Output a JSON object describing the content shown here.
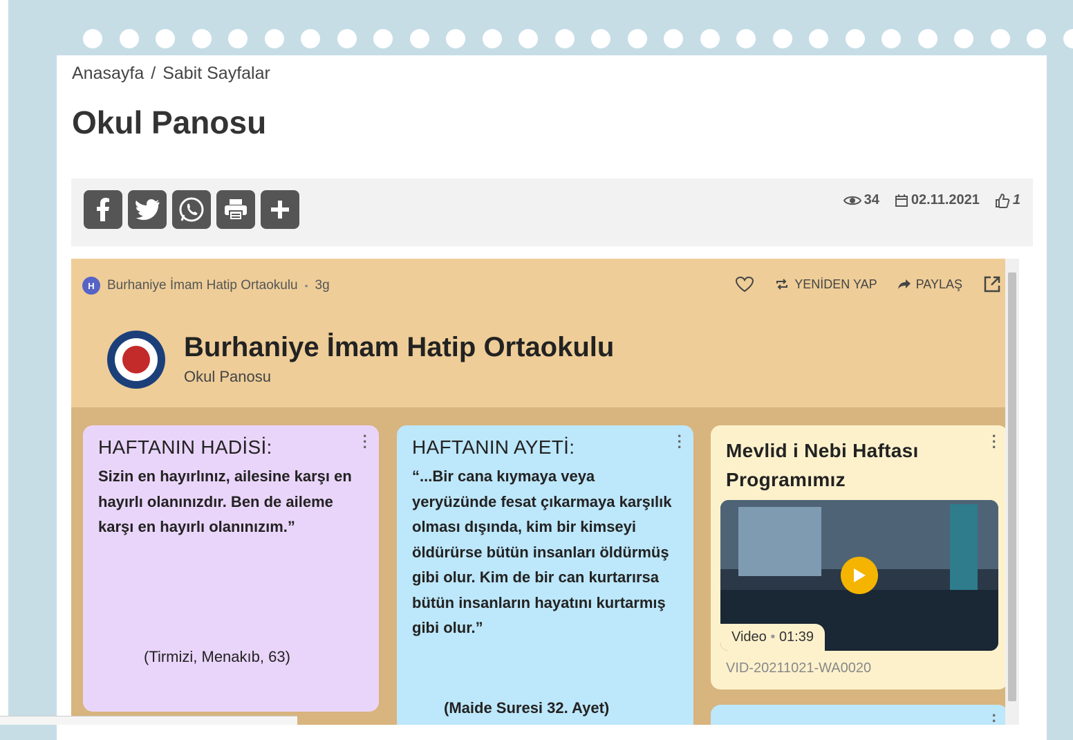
{
  "breadcrumb": {
    "home": "Anasayfa",
    "sep": "/",
    "current": "Sabit Sayfalar"
  },
  "page_title": "Okul Panosu",
  "share_buttons": [
    {
      "icon": "facebook-icon",
      "glyph": "f"
    },
    {
      "icon": "twitter-icon",
      "glyph": "t"
    },
    {
      "icon": "whatsapp-icon",
      "glyph": "w"
    },
    {
      "icon": "print-icon",
      "glyph": "p"
    },
    {
      "icon": "plus-icon",
      "glyph": "+"
    }
  ],
  "meta": {
    "views": "34",
    "date": "02.11.2021",
    "likes": "1"
  },
  "padlet": {
    "author": "Burhaniye İmam Hatip Ortaokulu",
    "author_initial": "H",
    "age": "3g",
    "remake": "YENİDEN YAP",
    "share": "PAYLAŞ",
    "title": "Burhaniye İmam Hatip Ortaokulu",
    "subtitle": "Okul Panosu"
  },
  "cards": {
    "hadis": {
      "title": "HAFTANIN HADİSİ:",
      "body": "Sizin en hayırlınız, ailesine karşı en hayırlı olanınızdır. Ben de aileme karşı en hayırlı olanınızım.”",
      "source": "(Tirmizi, Menakıb, 63)"
    },
    "ayet": {
      "title": "HAFTANIN AYETİ:",
      "body": "“...Bir cana kıymaya veya yeryüzünde fesat çıkarmaya karşılık olması dışında, kim bir kimseyi öldürürse bütün insanları öldürmüş gibi olur. Kim de bir can kurtarırsa bütün insanların hayatını kurtarmış gibi olur.”",
      "source": "(Maide Suresi 32. Ayet)"
    },
    "mevlid": {
      "title": "Mevlid i Nebi Haftası Programımız",
      "video_label": "Video",
      "duration": "01:39",
      "filename": "VID-20211021-WA0020"
    }
  },
  "colors": {
    "padlet_header": "#eecd98",
    "card_pink": "#ead5fa",
    "card_blue": "#bde7fa",
    "card_yellow": "#fdf1cc",
    "play": "#f4b400"
  }
}
